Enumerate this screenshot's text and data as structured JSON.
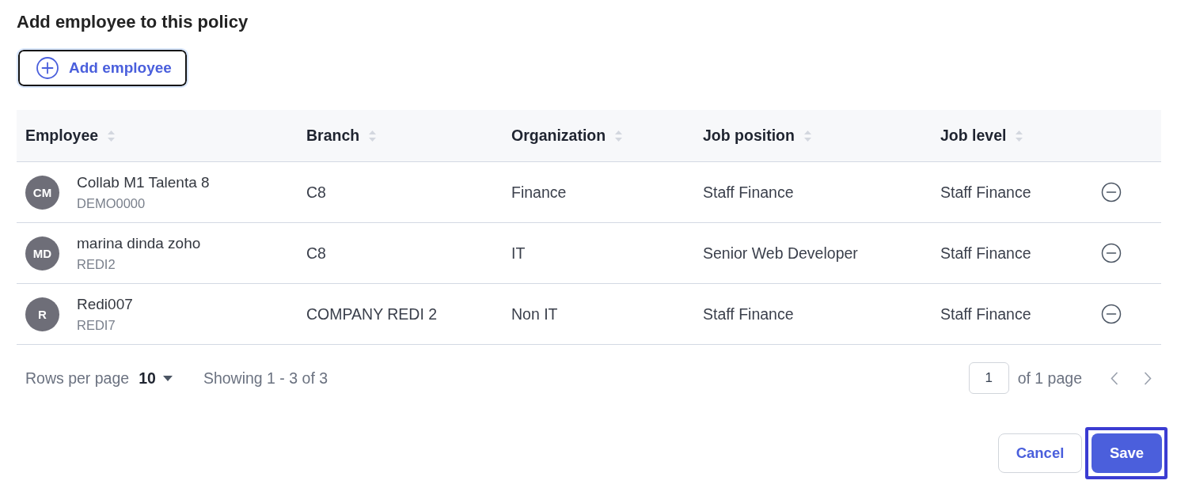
{
  "title": "Add employee to this policy",
  "add_button": {
    "label": "Add employee",
    "focused": true
  },
  "table": {
    "columns": [
      {
        "label": "Employee",
        "sortable": true
      },
      {
        "label": "Branch",
        "sortable": true
      },
      {
        "label": "Organization",
        "sortable": true
      },
      {
        "label": "Job position",
        "sortable": true
      },
      {
        "label": "Job level",
        "sortable": true
      }
    ],
    "rows": [
      {
        "initials": "CM",
        "name": "Collab M1 Talenta 8",
        "code": "DEMO0000",
        "branch": "C8",
        "organization": "Finance",
        "job_position": "Staff Finance",
        "job_level": "Staff Finance"
      },
      {
        "initials": "MD",
        "name": "marina dinda zoho",
        "code": "REDI2",
        "branch": "C8",
        "organization": "IT",
        "job_position": "Senior Web Developer",
        "job_level": "Staff Finance"
      },
      {
        "initials": "R",
        "name": "Redi007",
        "code": "REDI7",
        "branch": "COMPANY REDI 2",
        "organization": "Non IT",
        "job_position": "Staff Finance",
        "job_level": "Staff Finance"
      }
    ]
  },
  "pagination": {
    "rows_per_page_label": "Rows per page",
    "rows_per_page": "10",
    "summary": "Showing 1 - 3 of 3",
    "page": "1",
    "page_total": "of 1 page"
  },
  "actions": [
    {
      "label": "Cancel",
      "kind": "secondary",
      "focused": false
    },
    {
      "label": "Save",
      "kind": "primary",
      "focused": true
    }
  ]
}
